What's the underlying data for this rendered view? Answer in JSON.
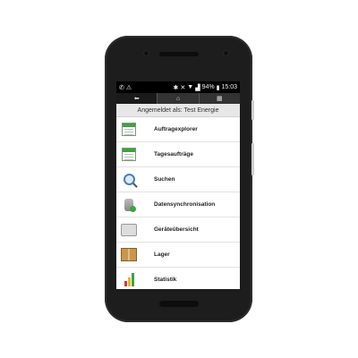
{
  "status_bar": {
    "left_icons": [
      "whatsapp-icon",
      "warning-icon"
    ],
    "right_icons": [
      "bluetooth-icon",
      "mute-icon",
      "wifi-icon",
      "signal-icon"
    ],
    "battery": "94%",
    "time": "15:03"
  },
  "nav": {
    "items": [
      {
        "name": "back",
        "symbol": "⬅",
        "active": true
      },
      {
        "name": "home",
        "symbol": "⌂",
        "active": false
      },
      {
        "name": "grid",
        "symbol": "▦",
        "active": false
      }
    ]
  },
  "login_text": "Angemeldet als: Test Energie",
  "menu": {
    "items": [
      {
        "label": "Auftragexplorer",
        "icon": "calendar-icon"
      },
      {
        "label": "Tagesaufträge",
        "icon": "calendar-day-icon"
      },
      {
        "label": "Suchen",
        "icon": "magnifier-icon"
      },
      {
        "label": "Datensynchronisation",
        "icon": "database-sync-icon"
      },
      {
        "label": "Geräteübersicht",
        "icon": "device-icon"
      },
      {
        "label": "Lager",
        "icon": "box-icon"
      },
      {
        "label": "Statistik",
        "icon": "bar-chart-icon"
      }
    ]
  },
  "colors": {
    "phone_body": "#1d1d1d",
    "nav_bar": "#333333",
    "accent_green": "#3ea33e"
  }
}
